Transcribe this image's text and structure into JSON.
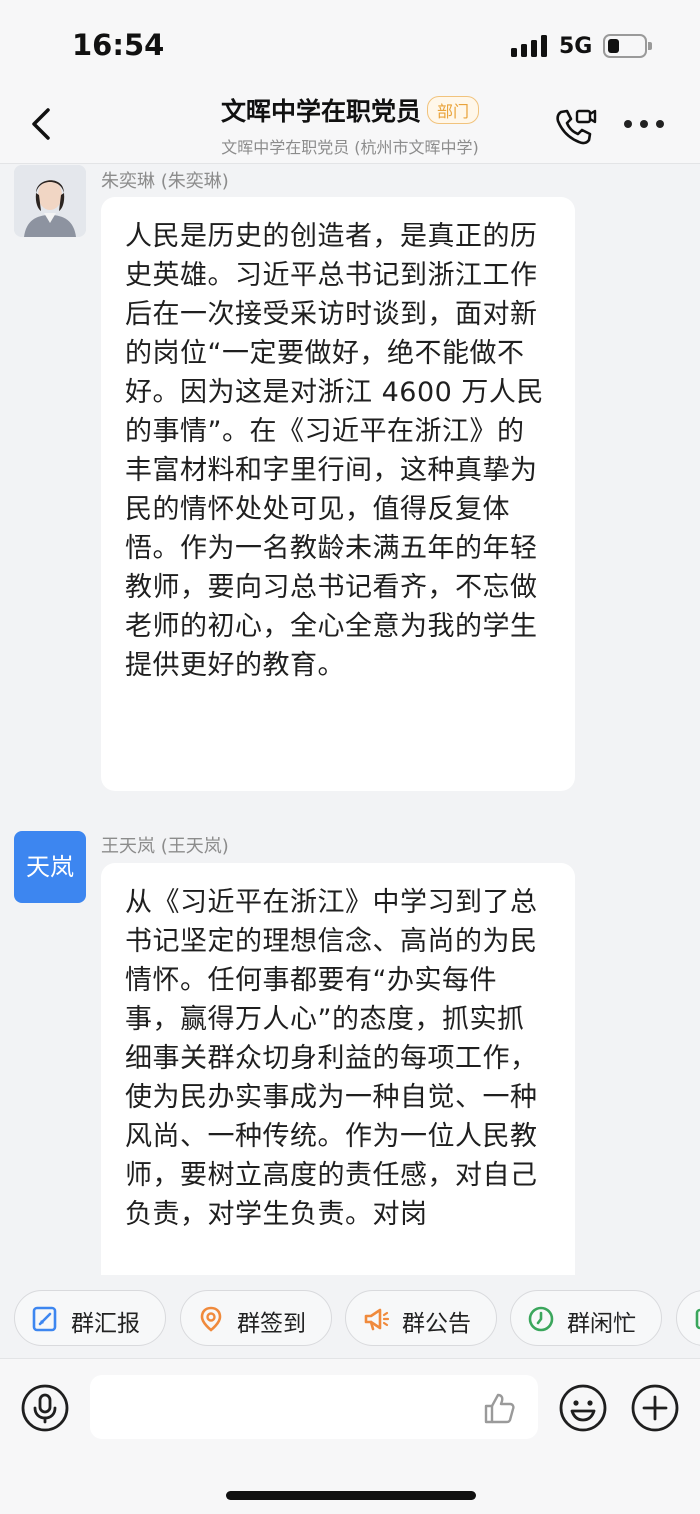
{
  "status_bar": {
    "time": "16:54",
    "network": "5G",
    "battery_level": 0.3
  },
  "header": {
    "title": "文晖中学在职党员",
    "badge": "部门",
    "subtitle": "文晖中学在职党员 (杭州市文晖中学)",
    "icons": [
      "back-icon",
      "call-icon",
      "more-icon"
    ]
  },
  "messages": [
    {
      "sender": "朱奕琳 (朱奕琳)",
      "avatar": "photo",
      "text": "人民是历史的创造者，是真正的历史英雄。习近平总书记到浙江工作后在一次接受采访时谈到，面对新的岗位“一定要做好，绝不能做不好。因为这是对浙江 4600 万人民的事情”。在《习近平在浙江》的丰富材料和字里行间，这种真挚为民的情怀处处可见，值得反复体悟。作为一名教龄未满五年的年轻教师，要向习总书记看齐，不忘做老师的初心，全心全意为我的学生提供更好的教育。"
    },
    {
      "sender": "王天岚 (王天岚)",
      "avatar": "天岚",
      "text": "从《习近平在浙江》中学习到了总书记坚定的理想信念、高尚的为民情怀。任何事都要有“办实每件事，赢得万人心”的态度，抓实抓细事关群众切身利益的每项工作，使为民办实事成为一种自觉、一种风尚、一种传统。作为一位人民教师，要树立高度的责任感，对自己负责，对学生负责。对岗"
    }
  ],
  "toolbar": {
    "chips": [
      {
        "label": "群汇报",
        "icon": "report-icon",
        "color": "#3d86f0"
      },
      {
        "label": "群签到",
        "icon": "location-icon",
        "color": "#f08a3c"
      },
      {
        "label": "群公告",
        "icon": "megaphone-icon",
        "color": "#f08a3c"
      },
      {
        "label": "群闲忙",
        "icon": "clock-icon",
        "color": "#3aa65c"
      }
    ]
  },
  "input_bar": {
    "icons": [
      "voice-icon",
      "like-icon",
      "emoji-icon",
      "plus-icon"
    ]
  }
}
